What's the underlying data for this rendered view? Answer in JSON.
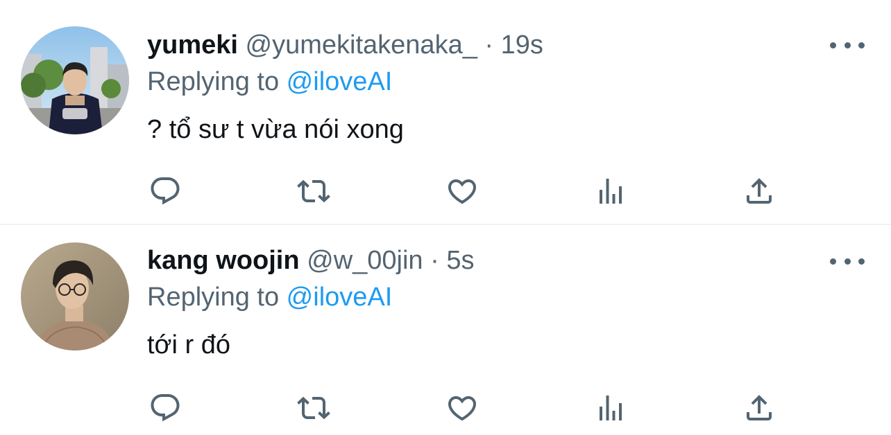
{
  "tweets": [
    {
      "name": "yumeki",
      "handle": "@yumekitakenaka_",
      "separator": "·",
      "time": "19s",
      "replying_prefix": "Replying to ",
      "replying_to": "@iloveAI",
      "text": "? tổ sư t vừa nói xong"
    },
    {
      "name": "kang woojin",
      "handle": "@w_00jin",
      "separator": "·",
      "time": "5s",
      "replying_prefix": "Replying to ",
      "replying_to": "@iloveAI",
      "text": "tới r đó"
    }
  ],
  "icons": {
    "reply": "reply-icon",
    "retweet": "retweet-icon",
    "like": "heart-icon",
    "views": "analytics-icon",
    "share": "share-icon",
    "more": "more-icon"
  },
  "colors": {
    "text_primary": "#0f1419",
    "text_secondary": "#536471",
    "accent": "#1d9bf0",
    "divider": "#eff3f4"
  }
}
